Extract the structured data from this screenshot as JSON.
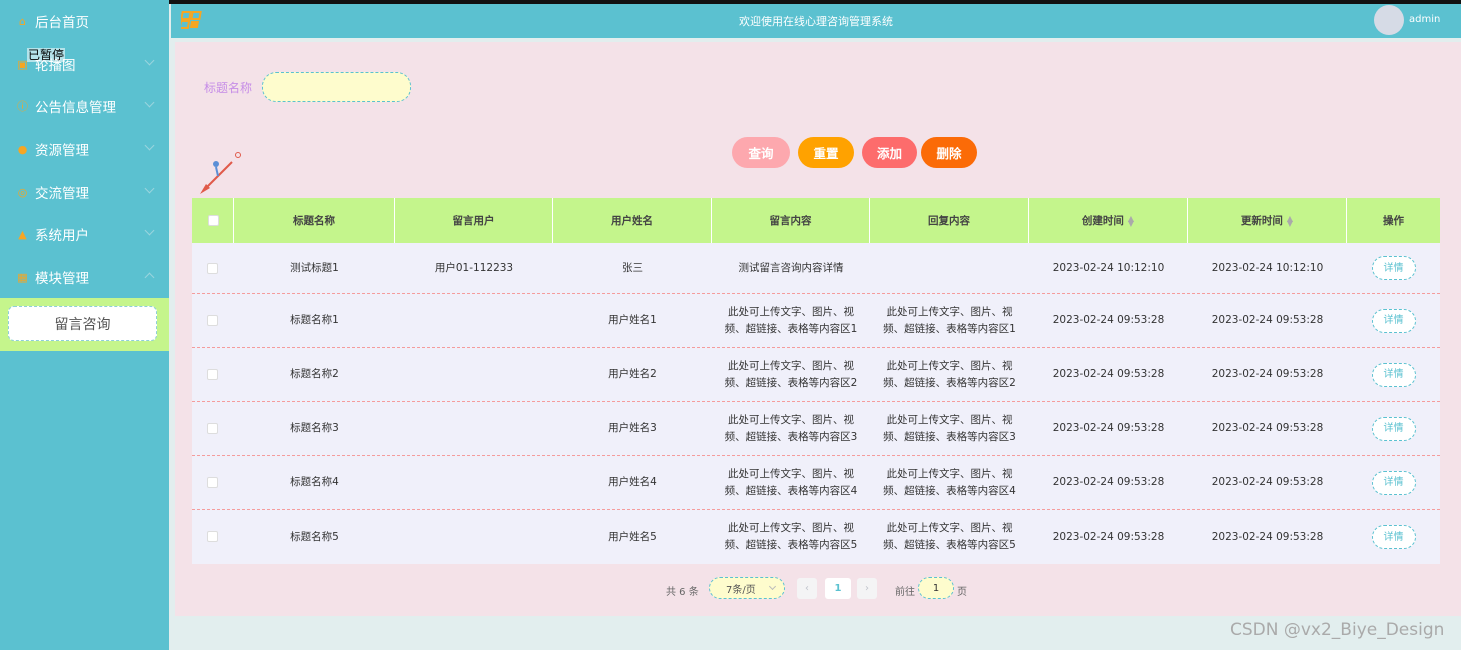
{
  "header": {
    "title": "欢迎使用在线心理咨询管理系统",
    "username": "admin"
  },
  "sidebar": {
    "items": [
      {
        "icon": "home-icon",
        "label": "后台首页",
        "expandable": false
      },
      {
        "icon": "image-icon",
        "label": "轮播图",
        "expandable": true
      },
      {
        "icon": "info-icon",
        "label": "公告信息管理",
        "expandable": true
      },
      {
        "icon": "location-icon",
        "label": "资源管理",
        "expandable": true
      },
      {
        "icon": "chat-icon",
        "label": "交流管理",
        "expandable": true
      },
      {
        "icon": "user-icon",
        "label": "系统用户",
        "expandable": true
      },
      {
        "icon": "grid-icon",
        "label": "模块管理",
        "expandable": true,
        "expanded": true
      }
    ],
    "overlay_text": "已暂停",
    "sub_item": "留言咨询"
  },
  "search": {
    "label": "标题名称",
    "value": ""
  },
  "buttons": {
    "query": "查询",
    "reset": "重置",
    "add": "添加",
    "delete": "删除"
  },
  "table": {
    "columns": [
      "标题名称",
      "留言用户",
      "用户姓名",
      "留言内容",
      "回复内容",
      "创建时间",
      "更新时间",
      "操作"
    ],
    "rows": [
      {
        "title": "测试标题1",
        "user": "用户01-112233",
        "name": "张三",
        "content": "测试留言咨询内容详情",
        "reply": "",
        "created": "2023-02-24 10:12:10",
        "updated": "2023-02-24 10:12:10",
        "action": "详情"
      },
      {
        "title": "标题名称1",
        "user": "",
        "name": "用户姓名1",
        "content": "此处可上传文字、图片、视频、超链接、表格等内容区1",
        "reply": "此处可上传文字、图片、视频、超链接、表格等内容区1",
        "created": "2023-02-24 09:53:28",
        "updated": "2023-02-24 09:53:28",
        "action": "详情"
      },
      {
        "title": "标题名称2",
        "user": "",
        "name": "用户姓名2",
        "content": "此处可上传文字、图片、视频、超链接、表格等内容区2",
        "reply": "此处可上传文字、图片、视频、超链接、表格等内容区2",
        "created": "2023-02-24 09:53:28",
        "updated": "2023-02-24 09:53:28",
        "action": "详情"
      },
      {
        "title": "标题名称3",
        "user": "",
        "name": "用户姓名3",
        "content": "此处可上传文字、图片、视频、超链接、表格等内容区3",
        "reply": "此处可上传文字、图片、视频、超链接、表格等内容区3",
        "created": "2023-02-24 09:53:28",
        "updated": "2023-02-24 09:53:28",
        "action": "详情"
      },
      {
        "title": "标题名称4",
        "user": "",
        "name": "用户姓名4",
        "content": "此处可上传文字、图片、视频、超链接、表格等内容区4",
        "reply": "此处可上传文字、图片、视频、超链接、表格等内容区4",
        "created": "2023-02-24 09:53:28",
        "updated": "2023-02-24 09:53:28",
        "action": "详情"
      },
      {
        "title": "标题名称5",
        "user": "",
        "name": "用户姓名5",
        "content": "此处可上传文字、图片、视频、超链接、表格等内容区5",
        "reply": "此处可上传文字、图片、视频、超链接、表格等内容区5",
        "created": "2023-02-24 09:53:28",
        "updated": "2023-02-24 09:53:28",
        "action": "详情"
      }
    ]
  },
  "pagination": {
    "total": "共 6 条",
    "page_size": "7条/页",
    "current_page": "1",
    "goto_prefix": "前往",
    "goto_value": "1",
    "goto_suffix": "页"
  },
  "watermark": "CSDN @vx2_Biye_Design",
  "colors": {
    "accent": "#5bc1d0",
    "header_row": "#c4f58c",
    "background": "#f4e2e8"
  }
}
